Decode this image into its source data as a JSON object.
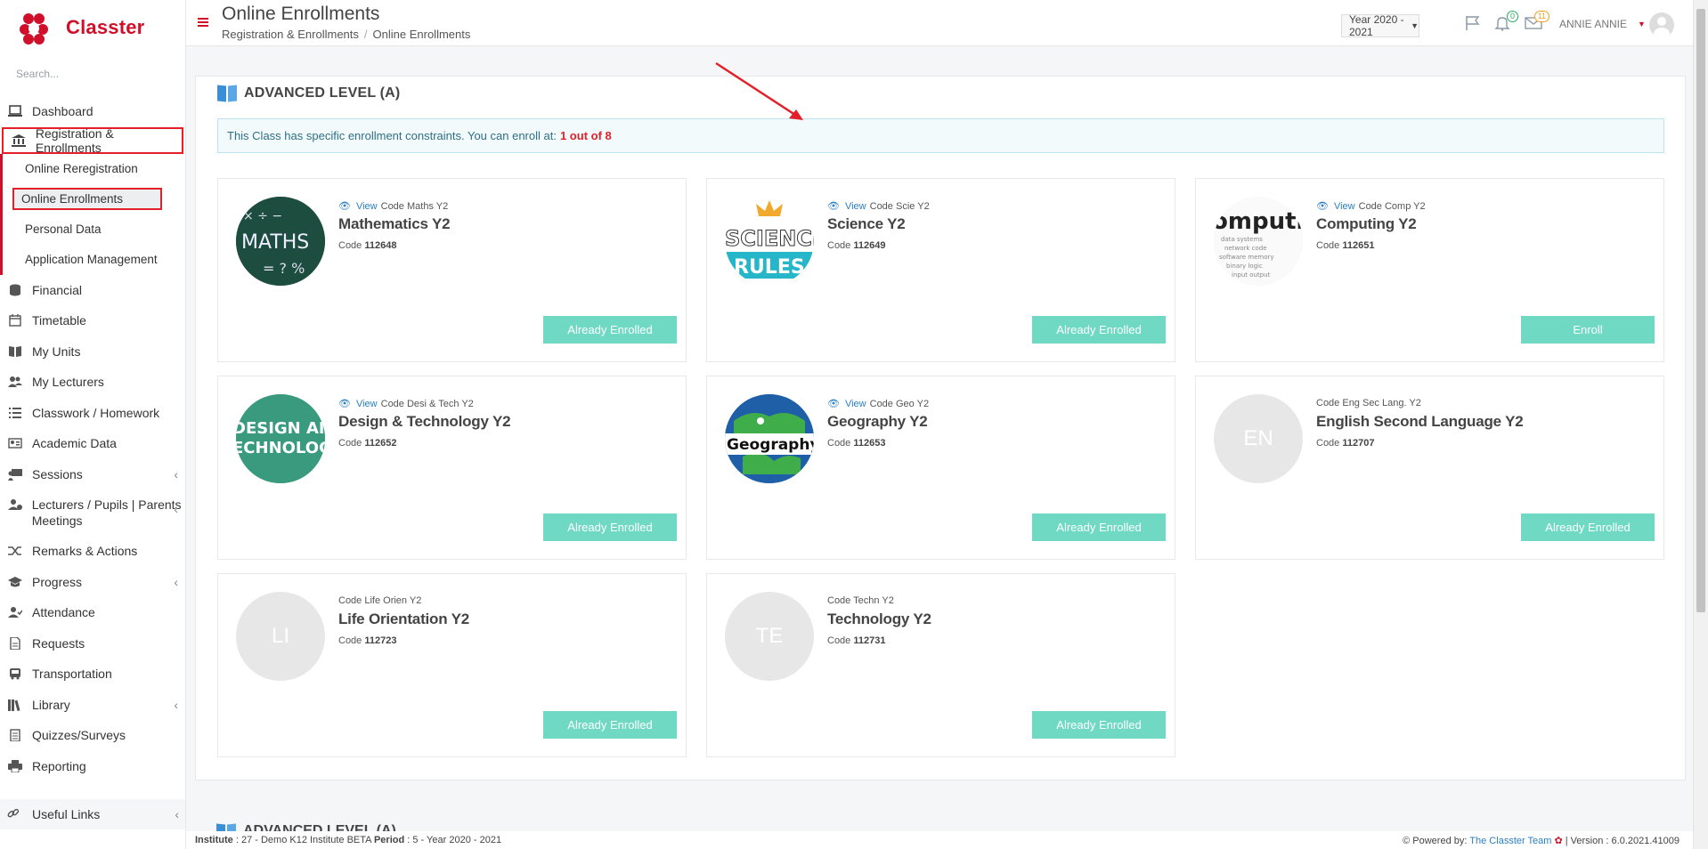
{
  "app": {
    "name": "Classter"
  },
  "sidebar": {
    "search_placeholder": "Search...",
    "items": [
      {
        "label": "Dashboard",
        "icon": "laptop-icon"
      },
      {
        "label": "Registration & Enrollments",
        "icon": "institution-icon"
      },
      {
        "label": "Financial",
        "icon": "coins-icon"
      },
      {
        "label": "Timetable",
        "icon": "calendar-icon"
      },
      {
        "label": "My Units",
        "icon": "book-icon"
      },
      {
        "label": "My Lecturers",
        "icon": "users-icon"
      },
      {
        "label": "Classwork / Homework",
        "icon": "list-icon"
      },
      {
        "label": "Academic Data",
        "icon": "id-card-icon"
      },
      {
        "label": "Sessions",
        "icon": "presentation-icon"
      },
      {
        "label": "Lecturers / Pupils | Parents Meetings",
        "icon": "user-meeting-icon"
      },
      {
        "label": "Remarks & Actions",
        "icon": "shuffle-icon"
      },
      {
        "label": "Progress",
        "icon": "graduation-cap-icon"
      },
      {
        "label": "Attendance",
        "icon": "user-check-icon"
      },
      {
        "label": "Requests",
        "icon": "file-icon"
      },
      {
        "label": "Transportation",
        "icon": "bus-icon"
      },
      {
        "label": "Library",
        "icon": "library-icon"
      },
      {
        "label": "Quizzes/Surveys",
        "icon": "clipboard-icon"
      },
      {
        "label": "Reporting",
        "icon": "printer-icon"
      }
    ],
    "submenu": [
      {
        "label": "Online Reregistration"
      },
      {
        "label": "Online Enrollments"
      },
      {
        "label": "Personal Data"
      },
      {
        "label": "Application Management"
      }
    ],
    "useful_links": "Useful Links"
  },
  "header": {
    "title": "Online Enrollments",
    "breadcrumb": [
      "Registration & Enrollments",
      "Online Enrollments"
    ],
    "year": "Year 2020 - 2021",
    "notifications_count": "0",
    "messages_count": "11",
    "user": "ANNIE ANNIE"
  },
  "section": {
    "title": "ADVANCED LEVEL (A)",
    "notice": "This Class has specific enrollment constraints. You can enroll at:",
    "notice_count": "1 out of 8",
    "next_title": "ADVANCED LEVEL (A)"
  },
  "courses": [
    {
      "view": "View",
      "code_label": "Code Maths Y2",
      "title": "Mathematics Y2",
      "code_prefix": "Code",
      "code": "112648",
      "button": "Already Enrolled",
      "thumb": "maths-image",
      "thumb_text": "MATHS"
    },
    {
      "view": "View",
      "code_label": "Code Scie Y2",
      "title": "Science Y2",
      "code_prefix": "Code",
      "code": "112649",
      "button": "Already Enrolled",
      "thumb": "science-image",
      "thumb_text": "SCIENCE"
    },
    {
      "view": "View",
      "code_label": "Code Comp Y2",
      "title": "Computing Y2",
      "code_prefix": "Code",
      "code": "112651",
      "button": "Enroll",
      "thumb": "computing-image",
      "thumb_text": "omputi"
    },
    {
      "view": "View",
      "code_label": "Code Desi & Tech Y2",
      "title": "Design & Technology Y2",
      "code_prefix": "Code",
      "code": "112652",
      "button": "Already Enrolled",
      "thumb": "design-image",
      "thumb_text": "DESIGN AN"
    },
    {
      "view": "View",
      "code_label": "Code Geo Y2",
      "title": "Geography Y2",
      "code_prefix": "Code",
      "code": "112653",
      "button": "Already Enrolled",
      "thumb": "geography-image",
      "thumb_text": "Geography"
    },
    {
      "view": "",
      "code_label": "Code Eng Sec Lang. Y2",
      "title": "English Second Language Y2",
      "code_prefix": "Code",
      "code": "112707",
      "button": "Already Enrolled",
      "thumb": "initials",
      "thumb_text": "EN"
    },
    {
      "view": "",
      "code_label": "Code Life Orien Y2",
      "title": "Life Orientation Y2",
      "code_prefix": "Code",
      "code": "112723",
      "button": "Already Enrolled",
      "thumb": "initials",
      "thumb_text": "LI"
    },
    {
      "view": "",
      "code_label": "Code Techn Y2",
      "title": "Technology Y2",
      "code_prefix": "Code",
      "code": "112731",
      "button": "Already Enrolled",
      "thumb": "initials",
      "thumb_text": "TE"
    }
  ],
  "footer": {
    "institute_label": "Institute",
    "institute": ": 27 - Demo K12 Institute BETA",
    "period_label": "Period",
    "period": ": 5 - Year 2020 - 2021",
    "powered": "Powered by:",
    "team": "The Classter Team",
    "version": "| Version : 6.0.2021.41009"
  },
  "colors": {
    "brand": "#d0102a",
    "button": "#6fd9c4",
    "link": "#2b7fc0",
    "annotation": "#e3202a"
  }
}
